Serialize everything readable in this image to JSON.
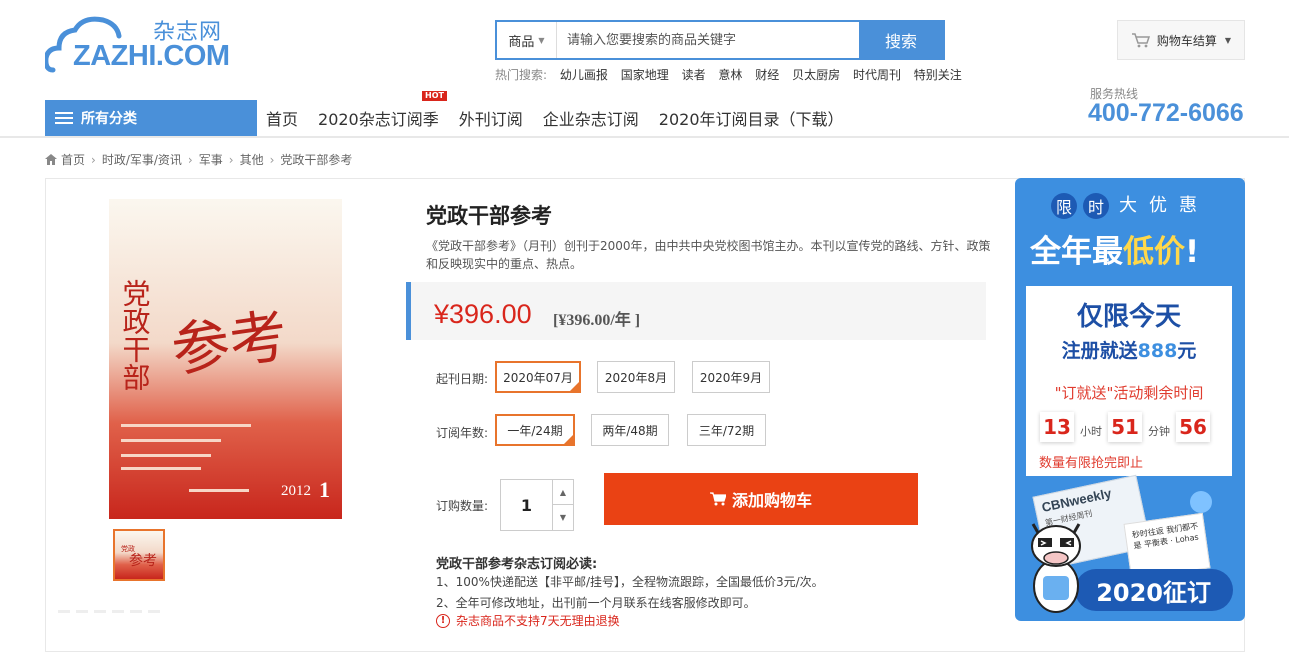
{
  "logo": {
    "cn": "杂志网",
    "en": "ZAZHI.COM"
  },
  "search": {
    "category": "商品",
    "placeholder": "请输入您要搜索的商品关键字",
    "button": "搜索",
    "hot_label": "热门搜索:",
    "hot_keywords": [
      "幼儿画报",
      "国家地理",
      "读者",
      "意林",
      "财经",
      "贝太厨房",
      "时代周刊",
      "特别关注"
    ]
  },
  "cart": {
    "label": "购物车结算"
  },
  "hotline": {
    "label": "服务热线",
    "number": "400-772-6066"
  },
  "nav": {
    "all_categories": "所有分类",
    "items": [
      "首页",
      "2020杂志订阅季",
      "外刊订阅",
      "企业杂志订阅",
      "2020年订阅目录（下载）"
    ],
    "hot_badge": "HOT"
  },
  "breadcrumb": [
    "首页",
    "时政/军事/资讯",
    "军事",
    "其他",
    "党政干部参考"
  ],
  "product": {
    "title": "党政干部参考",
    "description": "《党政干部参考》（月刊）创刊于2000年，由中共中央党校图书馆主办。本刊以宣传党的路线、方针、政策和反映现实中的重点、热点。",
    "price": "¥396.00",
    "price_sub": "[¥396.00/年 ]",
    "cover": {
      "title_chars": "党政干部",
      "subtitle": "参考",
      "year": "2012",
      "issue": "1"
    }
  },
  "options": {
    "start_label": "起刊日期:",
    "start": [
      "2020年07月",
      "2020年8月",
      "2020年9月"
    ],
    "years_label": "订阅年数:",
    "years": [
      "一年/24期",
      "两年/48期",
      "三年/72期"
    ],
    "qty_label": "订购数量:",
    "qty": "1",
    "add_to_cart": "添加购物车"
  },
  "notice": {
    "title": "党政干部参考杂志订阅必读:",
    "lines": [
      "1、100%快递配送【非平邮/挂号】，全程物流跟踪，全国最低价3元/次。",
      "2、全年可修改地址，出刊前一个月联系在线客服修改即可。"
    ],
    "warning": "杂志商品不支持7天无理由退换"
  },
  "ad": {
    "circles": [
      "限",
      "时"
    ],
    "plain": [
      "大",
      "优",
      "惠"
    ],
    "big_pre": "全年",
    "big_mid": "最",
    "big_em": "低价",
    "big_post": "!",
    "card_t1": "仅限今天",
    "card_t2_pre": "注册就送",
    "card_t2_em": "888",
    "card_t2_post": "元",
    "card_t3": "\"订就送\"活动剩余时间",
    "countdown": {
      "h": "13",
      "h_unit": "小时",
      "m": "51",
      "m_unit": "分钟",
      "s": "56"
    },
    "card_t4": "数量有限抢完即止",
    "mag1": "CBNweekly",
    "mag1_sub": "第一财经周刊",
    "mag2": "秒时往返 我们都不是 平衡表 · Lohas",
    "pill": "2020征订"
  },
  "colors": {
    "brand": "#4a90d9",
    "price": "#d9261c",
    "cta": "#ea4214",
    "selected": "#e8742c"
  }
}
